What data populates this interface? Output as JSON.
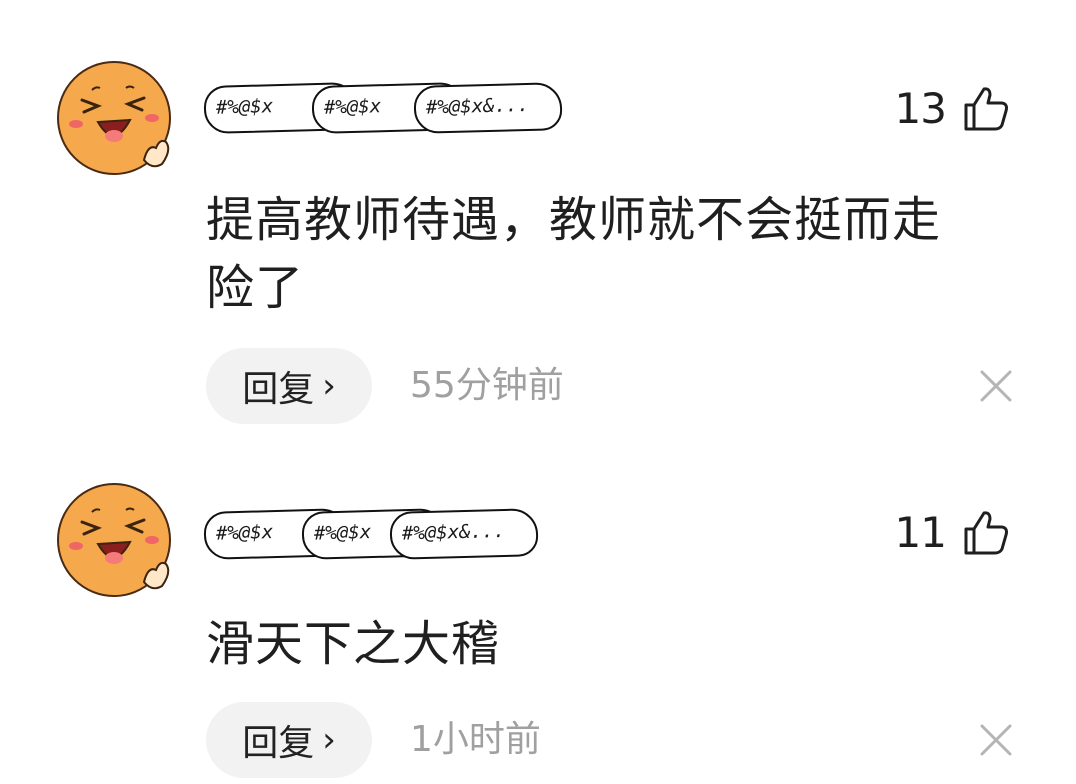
{
  "comments": [
    {
      "badges": [
        "#%@$x",
        "#%@$x",
        "#%@$x&..."
      ],
      "likes": "13",
      "text_line1": "提高教师待遇，教师就不会挺而走",
      "text_line2": "险了",
      "reply_label": "回复",
      "reply_chevron": "›",
      "time": "55分钟前"
    },
    {
      "badges": [
        "#%@$x",
        "#%@$x",
        "#%@$x&..."
      ],
      "likes": "11",
      "text_line1": "滑天下之大稽",
      "text_line2": "",
      "reply_label": "回复",
      "reply_chevron": "›",
      "time": "1小时前"
    }
  ],
  "icons": {
    "like": "thumbs-up-icon",
    "close": "close-icon",
    "avatar": "laughing-emoji-avatar"
  },
  "colors": {
    "avatar_fill": "#f6a84c",
    "reply_bg": "#f2f2f2",
    "time_text": "#a0a0a0",
    "close_icon": "#b5b5b5"
  }
}
